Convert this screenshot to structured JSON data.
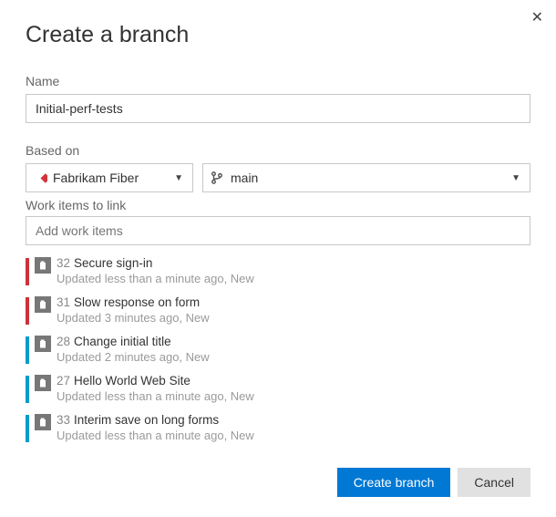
{
  "dialog": {
    "title": "Create a branch"
  },
  "name_field": {
    "label": "Name",
    "value": "Initial-perf-tests"
  },
  "based_on": {
    "label": "Based on",
    "repo": "Fabrikam Fiber",
    "branch": "main"
  },
  "work_items_link": {
    "label": "Work items to link",
    "placeholder": "Add work items"
  },
  "work_items": [
    {
      "color": "#cb333b",
      "id": "32",
      "title": "Secure sign-in",
      "sub": "Updated less than a minute ago, New"
    },
    {
      "color": "#cb333b",
      "id": "31",
      "title": "Slow response on form",
      "sub": "Updated 3 minutes ago, New"
    },
    {
      "color": "#009ccc",
      "id": "28",
      "title": "Change initial title",
      "sub": "Updated 2 minutes ago, New"
    },
    {
      "color": "#009ccc",
      "id": "27",
      "title": "Hello World Web Site",
      "sub": "Updated less than a minute ago, New"
    },
    {
      "color": "#009ccc",
      "id": "33",
      "title": "Interim save on long forms",
      "sub": "Updated less than a minute ago, New"
    }
  ],
  "footer": {
    "primary": "Create branch",
    "secondary": "Cancel"
  }
}
